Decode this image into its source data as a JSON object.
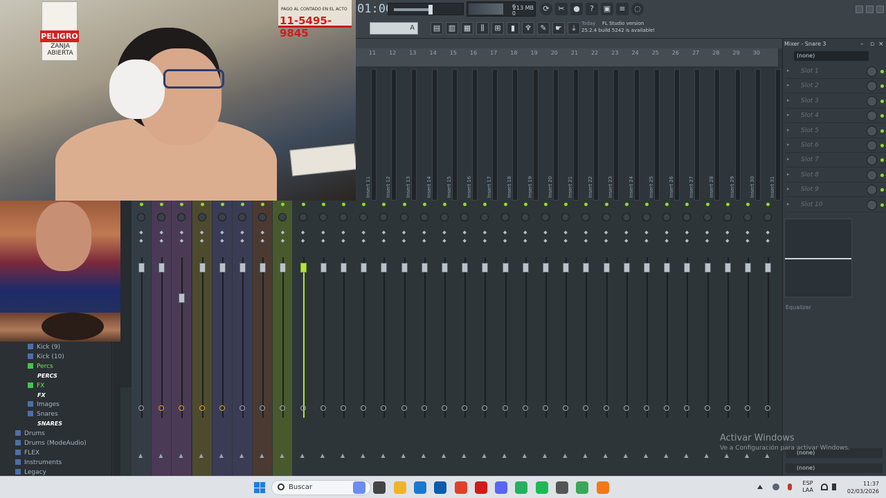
{
  "webcam": {
    "sign_text": "PELIGRO",
    "sign_sub": "ZANJA ABIERTA",
    "banner_small": "PAGO AL CONTADO EN EL ACTO",
    "banner_phone": "11-5495-9845"
  },
  "toolbar": {
    "time": "01:00",
    "cpu_top": "6",
    "cpu_bottom": "0",
    "memory": "213 MB",
    "snap_value": "A",
    "news_day": "Today",
    "news_title": "FL Studio version",
    "news_body": "25.2.4 build 5242 is available!"
  },
  "mixer": {
    "ruler_ticks": [
      "11",
      "12",
      "13",
      "14",
      "15",
      "16",
      "17",
      "18",
      "19",
      "20",
      "21",
      "22",
      "23",
      "24",
      "25",
      "26",
      "27",
      "28",
      "29",
      "30"
    ],
    "insert_names": [
      "Insert 11",
      "Insert 12",
      "Insert 13",
      "Insert 14",
      "Insert 15",
      "Insert 16",
      "Insert 17",
      "Insert 18",
      "Insert 19",
      "Insert 20",
      "Insert 21",
      "Insert 22",
      "Insert 23",
      "Insert 24",
      "Insert 25",
      "Insert 26",
      "Insert 27",
      "Insert 28",
      "Insert 29",
      "Insert 30",
      "Insert 31"
    ],
    "active_channel_color": "#b5e43a",
    "led_color": "#8ddc2c"
  },
  "right_panel": {
    "title": "Mixer - Snare 3",
    "input_select": "(none)",
    "slots": [
      "Slot 1",
      "Slot 2",
      "Slot 3",
      "Slot 4",
      "Slot 5",
      "Slot 6",
      "Slot 7",
      "Slot 8",
      "Slot 9",
      "Slot 10"
    ],
    "eq_label": "Equalizer",
    "output_a": "(none)",
    "output_b": "(none)"
  },
  "watermark": {
    "line1": "Activar Windows",
    "line2": "Ve a Configuración para activar Windows."
  },
  "browser": {
    "items": [
      {
        "label": "Kick (9)",
        "style": "normal",
        "icon": "folder-icon"
      },
      {
        "label": "Kick (10)",
        "style": "normal",
        "icon": "folder-icon"
      },
      {
        "label": "Percs",
        "style": "green",
        "icon": "headphones-icon"
      },
      {
        "label": "PERCS",
        "style": "white",
        "icon": ""
      },
      {
        "label": "FX",
        "style": "green",
        "icon": "headphones-icon"
      },
      {
        "label": "FX",
        "style": "white",
        "icon": ""
      },
      {
        "label": "Images",
        "style": "normal",
        "icon": "folder-icon"
      },
      {
        "label": "Snares",
        "style": "normal",
        "icon": "headphones-icon"
      },
      {
        "label": "SNARES",
        "style": "white",
        "icon": ""
      },
      {
        "label": "Drums",
        "style": "normal",
        "icon": "folder-icon"
      },
      {
        "label": "Drums (ModeAudio)",
        "style": "normal",
        "icon": "folder-icon"
      },
      {
        "label": "FLEX",
        "style": "normal",
        "icon": "folder-icon"
      },
      {
        "label": "Instruments",
        "style": "normal",
        "icon": "folder-icon"
      },
      {
        "label": "Legacy",
        "style": "normal",
        "icon": "folder-icon"
      }
    ]
  },
  "taskbar": {
    "search_label": "Buscar",
    "lang_top": "ESP",
    "lang_bottom": "LAA",
    "time": "11:37",
    "date": "02/03/2026",
    "apps": [
      "copilot-icon",
      "task-view-icon",
      "file-explorer-icon",
      "edge-icon",
      "outlook-icon",
      "brave-icon",
      "opera-icon",
      "discord-icon",
      "whatsapp-icon",
      "spotify-icon",
      "app-window-icon",
      "chrome-icon",
      "fl-studio-icon"
    ]
  }
}
